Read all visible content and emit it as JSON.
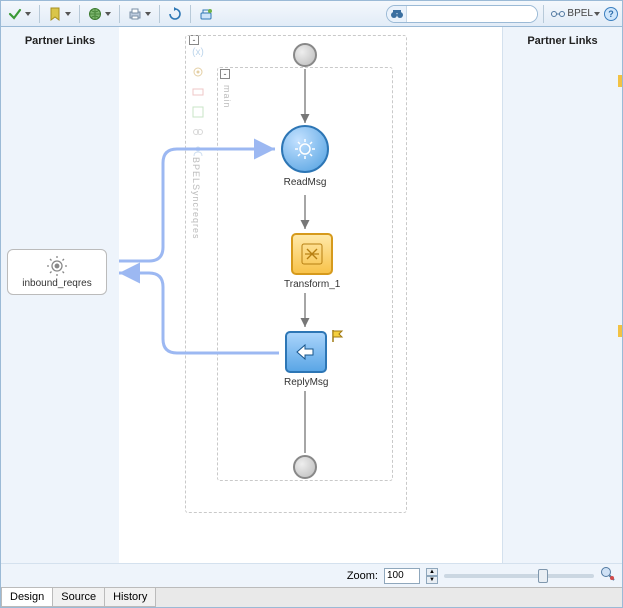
{
  "toolbar": {
    "bpel_label": "BPEL",
    "search_placeholder": ""
  },
  "partner_headers": {
    "left": "Partner Links",
    "right": "Partner Links"
  },
  "partner_link": {
    "name": "inbound_reqres"
  },
  "palette_vert_labels": {
    "main": "main",
    "bpel_sync": "BPELSyncreqres"
  },
  "nodes": {
    "receive": "ReadMsg",
    "transform": "Transform_1",
    "reply": "ReplyMsg"
  },
  "zoom": {
    "label": "Zoom:",
    "value": "100",
    "slider_pos": 0.66
  },
  "tabs": [
    "Design",
    "Source",
    "History"
  ],
  "active_tab": "Design"
}
